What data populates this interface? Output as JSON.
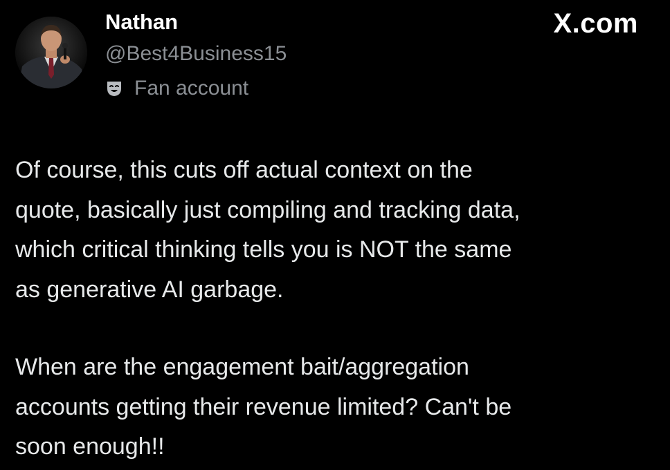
{
  "post": {
    "author_name": "Nathan",
    "author_handle": "@Best4Business15",
    "account_label": "Fan account",
    "account_label_icon": "theater-mask-icon",
    "site": "X.com",
    "paragraphs": [
      "Of course, this cuts off actual context on the\nquote, basically just compiling and tracking data,\nwhich critical thinking tells you is NOT the same\nas generative AI garbage.",
      "When are the engagement bait/aggregation\naccounts getting their revenue limited? Can't be\nsoon enough!!"
    ]
  },
  "colors": {
    "background": "#000000",
    "name": "#ffffff",
    "secondary_text": "#8b8f94",
    "body_text": "#e7e9ea"
  }
}
